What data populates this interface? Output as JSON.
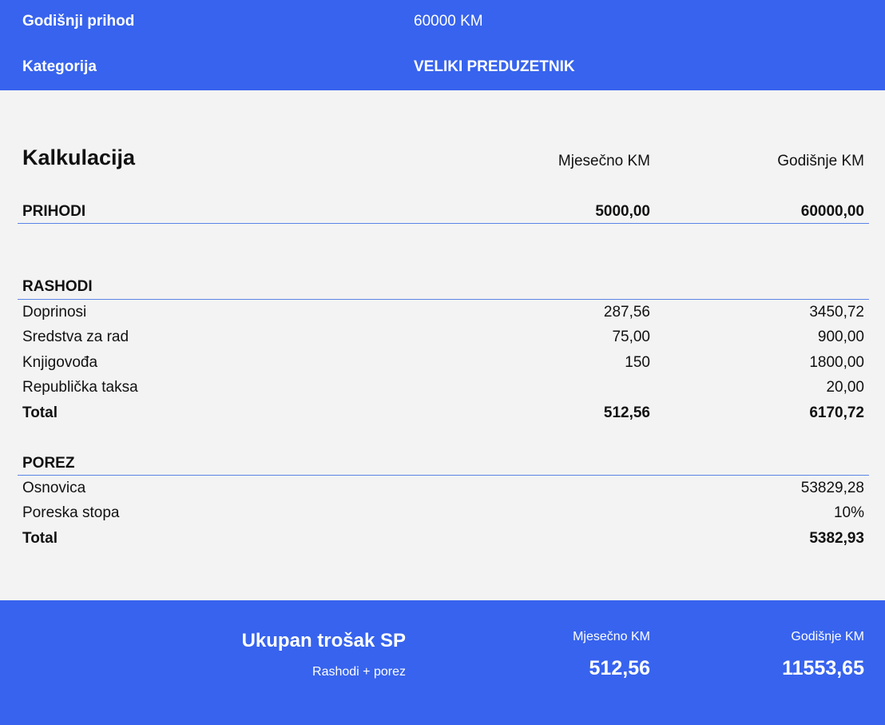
{
  "header": {
    "income_label": "Godišnji prihod",
    "income_value": "60000 KM",
    "category_label": "Kategorija",
    "category_value": "VELIKI PREDUZETNIK"
  },
  "calc": {
    "title": "Kalkulacija",
    "col_monthly": "Mjesečno KM",
    "col_yearly": "Godišnje KM",
    "income": {
      "label": "PRIHODI",
      "monthly": "5000,00",
      "yearly": "60000,00"
    },
    "expenses": {
      "label": "RASHODI",
      "rows": [
        {
          "label": "Doprinosi",
          "monthly": "287,56",
          "yearly": "3450,72"
        },
        {
          "label": "Sredstva za rad",
          "monthly": "75,00",
          "yearly": "900,00"
        },
        {
          "label": "Knjigovođa",
          "monthly": "150",
          "yearly": "1800,00"
        },
        {
          "label": "Republička taksa",
          "monthly": "",
          "yearly": "20,00"
        }
      ],
      "total": {
        "label": "Total",
        "monthly": "512,56",
        "yearly": "6170,72"
      }
    },
    "tax": {
      "label": "POREZ",
      "rows": [
        {
          "label": "Osnovica",
          "yearly": "53829,28"
        },
        {
          "label": "Poreska stopa",
          "yearly": "10%"
        }
      ],
      "total": {
        "label": "Total",
        "yearly": "5382,93"
      }
    }
  },
  "summary": {
    "title": "Ukupan trošak SP",
    "subtitle": "Rashodi + porez",
    "col_monthly": "Mjesečno KM",
    "col_yearly": "Godišnje KM",
    "monthly": "512,56",
    "yearly": "11553,65"
  },
  "colors": {
    "accent": "#3763ee",
    "divider": "#5a84e6",
    "background": "#f3f3f3"
  }
}
